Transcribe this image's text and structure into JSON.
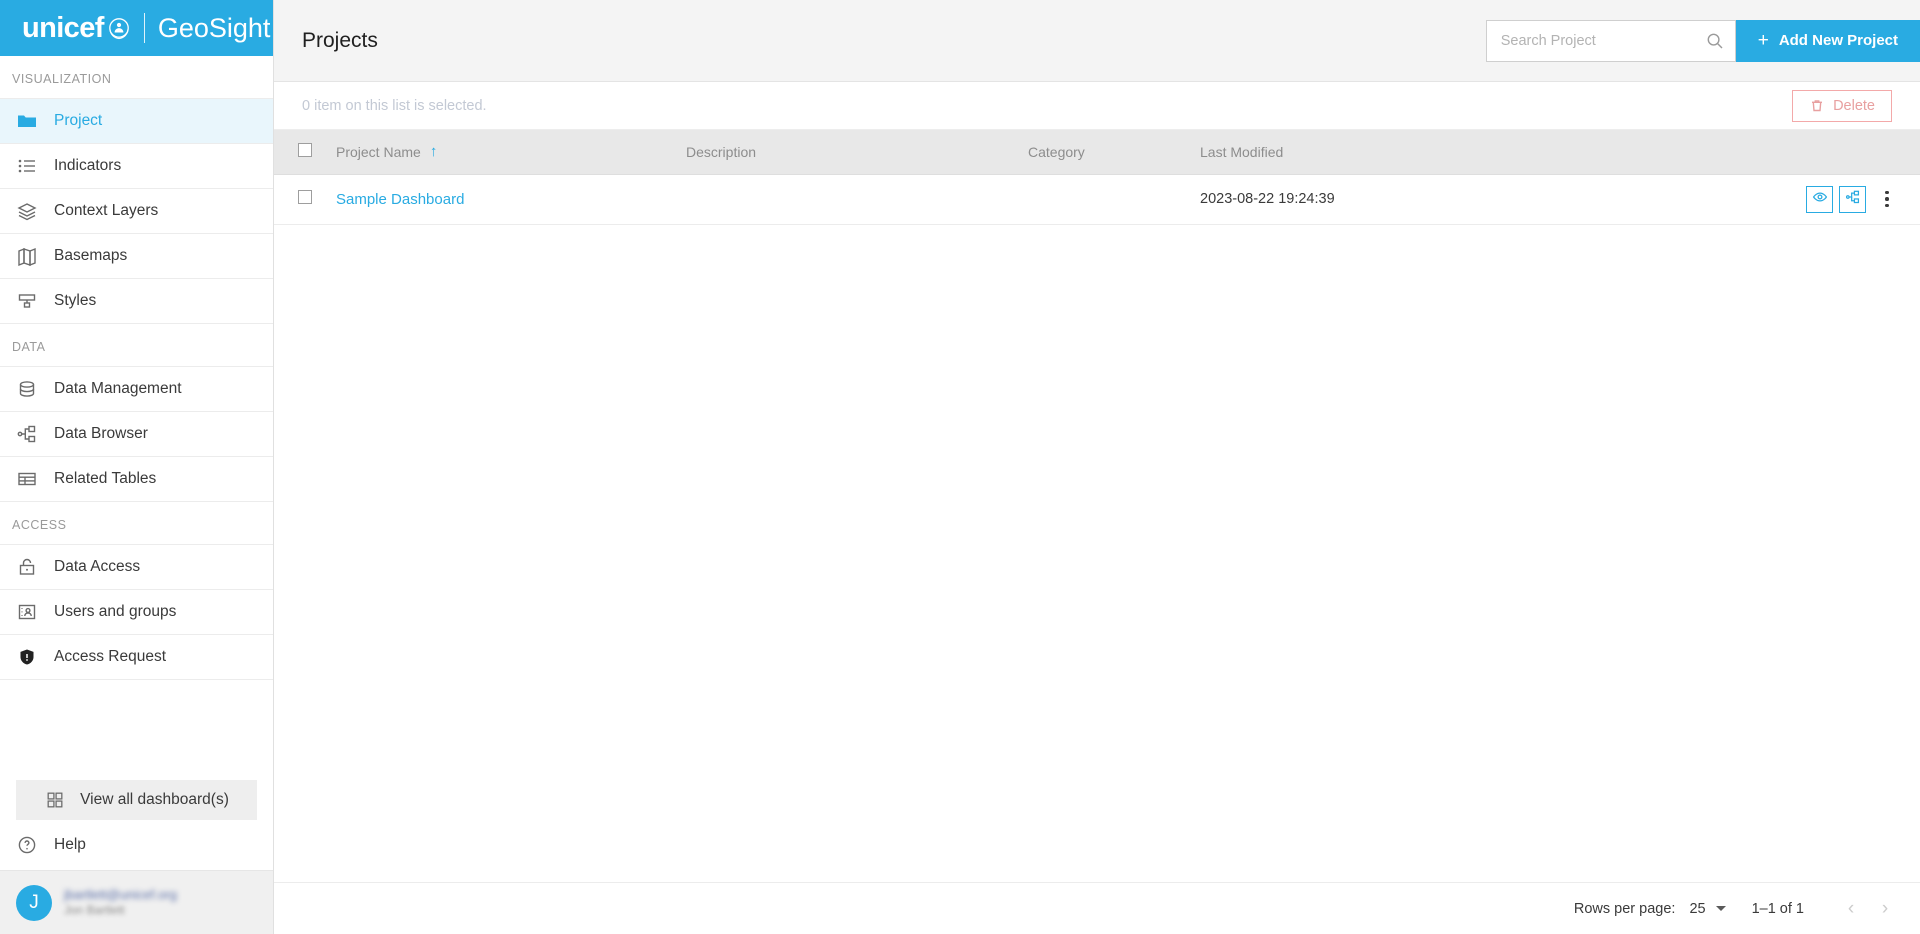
{
  "brand": {
    "unicef": "unicef",
    "app": "GeoSight",
    "emblem_icon": "unicef-emblem-icon",
    "accent_color": "#29ABE2"
  },
  "sidebar": {
    "groups": [
      {
        "title": "VISUALIZATION",
        "items": [
          {
            "label": "Project",
            "icon": "folder-icon",
            "active": true
          },
          {
            "label": "Indicators",
            "icon": "list-icon",
            "active": false
          },
          {
            "label": "Context Layers",
            "icon": "layers-icon",
            "active": false
          },
          {
            "label": "Basemaps",
            "icon": "map-icon",
            "active": false
          },
          {
            "label": "Styles",
            "icon": "paint-roller-icon",
            "active": false
          }
        ]
      },
      {
        "title": "DATA",
        "items": [
          {
            "label": "Data Management",
            "icon": "database-icon",
            "active": false
          },
          {
            "label": "Data Browser",
            "icon": "sitemap-icon",
            "active": false
          },
          {
            "label": "Related Tables",
            "icon": "table-icon",
            "active": false
          }
        ]
      },
      {
        "title": "ACCESS",
        "items": [
          {
            "label": "Data Access",
            "icon": "unlock-icon",
            "active": false
          },
          {
            "label": "Users and groups",
            "icon": "user-card-icon",
            "active": false
          },
          {
            "label": "Access Request",
            "icon": "shield-alert-icon",
            "active": false
          }
        ]
      }
    ],
    "dashboard_button": {
      "label": "View all dashboard(s)",
      "icon": "grid-icon"
    },
    "help": {
      "label": "Help",
      "icon": "question-circle-icon"
    },
    "profile": {
      "avatar_initial": "J",
      "email": "jbartlett@unicef.org",
      "name": "Jon Bartlett"
    }
  },
  "header": {
    "title": "Projects",
    "search": {
      "placeholder": "Search Project",
      "value": "",
      "icon": "search-icon"
    },
    "add_button": {
      "label": "Add New Project",
      "plus": "+"
    }
  },
  "select_bar": {
    "status": "0 item on this list is selected.",
    "delete_button": {
      "label": "Delete",
      "icon": "trash-icon",
      "disabled": true
    }
  },
  "table": {
    "columns": [
      {
        "key": "name",
        "label": "Project Name",
        "sort": "asc",
        "sort_glyph": "↑"
      },
      {
        "key": "description",
        "label": "Description"
      },
      {
        "key": "category",
        "label": "Category"
      },
      {
        "key": "modified",
        "label": "Last Modified"
      }
    ],
    "rows": [
      {
        "checked": false,
        "name": "Sample Dashboard",
        "description": "",
        "category": "",
        "modified": "2023-08-22 19:24:39",
        "actions": [
          {
            "name": "preview-button",
            "icon": "eye-icon"
          },
          {
            "name": "data-browser-button",
            "icon": "sitemap-icon"
          },
          {
            "name": "more-menu-button",
            "icon": "kebab-icon"
          }
        ]
      }
    ]
  },
  "pagination": {
    "rows_per_page_label": "Rows per page:",
    "rows_per_page_value": "25",
    "range_label": "1–1 of 1",
    "prev_glyph": "‹",
    "next_glyph": "›"
  }
}
